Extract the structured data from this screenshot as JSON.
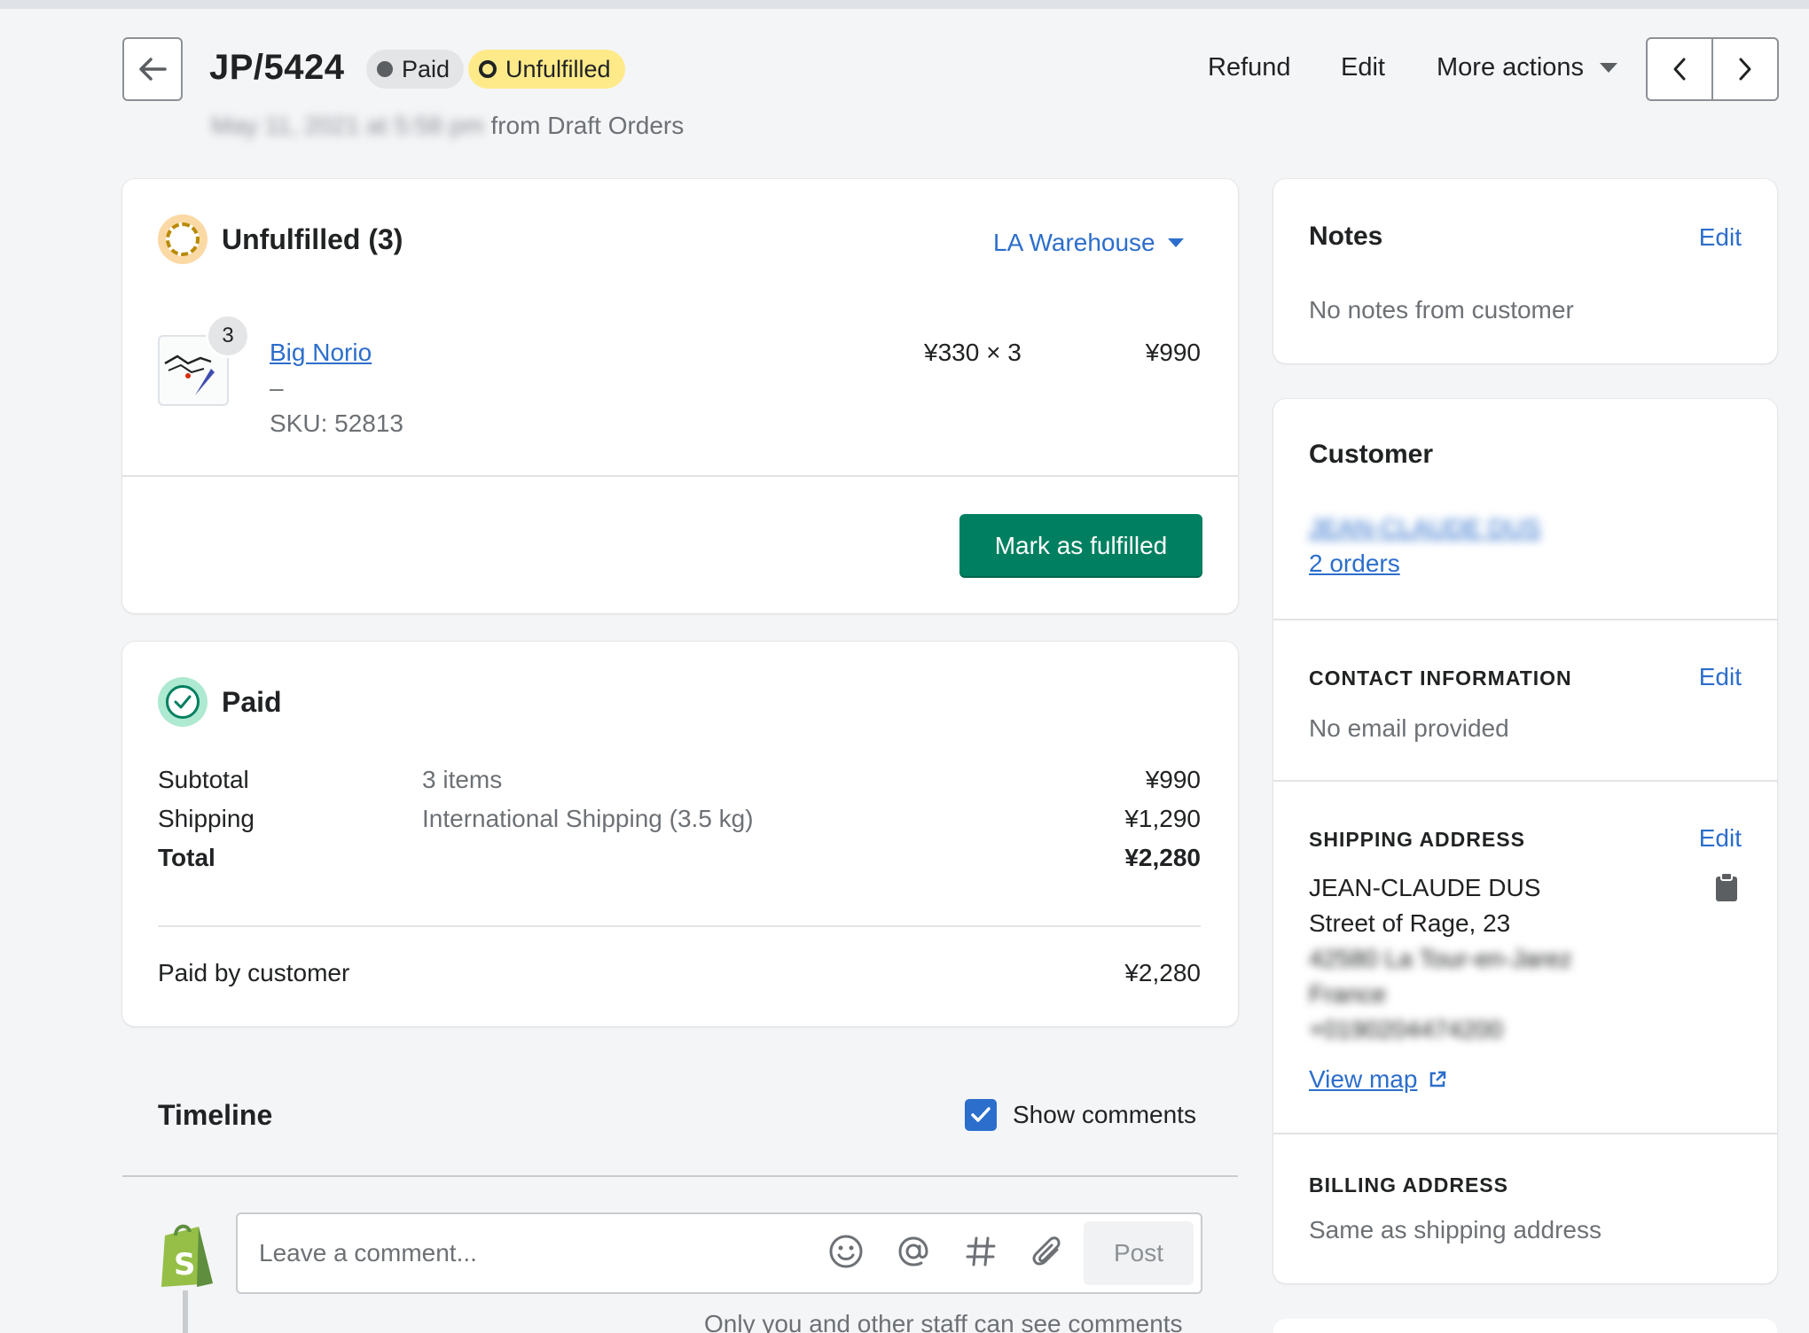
{
  "header": {
    "order_number": "JP/5424",
    "badge_paid": "Paid",
    "badge_unfulfilled": "Unfulfilled",
    "date_blurred": "May 11, 2021 at 5:58 pm",
    "source": "from Draft Orders",
    "actions": {
      "refund": "Refund",
      "edit": "Edit",
      "more": "More actions"
    }
  },
  "unfulfilled": {
    "heading": "Unfulfilled (3)",
    "location": "LA Warehouse",
    "item": {
      "quantity_badge": "3",
      "name": "Big Norio",
      "variant": "–",
      "sku": "SKU: 52813",
      "unit_price": "¥330 × 3",
      "line_total": "¥990"
    },
    "fulfill_button": "Mark as fulfilled"
  },
  "payment": {
    "heading": "Paid",
    "rows": [
      {
        "label": "Subtotal",
        "description": "3 items",
        "amount": "¥990"
      },
      {
        "label": "Shipping",
        "description": "International Shipping (3.5 kg)",
        "amount": "¥1,290"
      },
      {
        "label": "Total",
        "description": "",
        "amount": "¥2,280"
      }
    ],
    "paid_by": {
      "label": "Paid by customer",
      "amount": "¥2,280"
    }
  },
  "timeline": {
    "heading": "Timeline",
    "show_comments_label": "Show comments",
    "show_comments_checked": true,
    "comment_placeholder": "Leave a comment...",
    "post_button": "Post",
    "hint": "Only you and other staff can see comments"
  },
  "notes": {
    "heading": "Notes",
    "edit": "Edit",
    "text": "No notes from customer"
  },
  "customer": {
    "heading": "Customer",
    "name_blurred": "JEAN-CLAUDE DUS",
    "orders_link": "2 orders",
    "contact": {
      "heading": "CONTACT INFORMATION",
      "edit": "Edit",
      "text": "No email provided"
    },
    "shipping": {
      "heading": "SHIPPING ADDRESS",
      "edit": "Edit",
      "name": "JEAN-CLAUDE DUS",
      "street": "Street of Rage, 23",
      "city_blurred": "42580 La Tour-en-Jarez",
      "country_blurred": "France",
      "phone_blurred": "+0190204474200",
      "view_map": "View map"
    },
    "billing": {
      "heading": "BILLING ADDRESS",
      "text": "Same as shipping address"
    }
  },
  "colors": {
    "primary_button": "#008060",
    "link": "#2c6ecb",
    "unfulfilled_badge": "#ffea8a",
    "paid_badge": "#e4e5e7",
    "background": "#f4f5f7"
  }
}
